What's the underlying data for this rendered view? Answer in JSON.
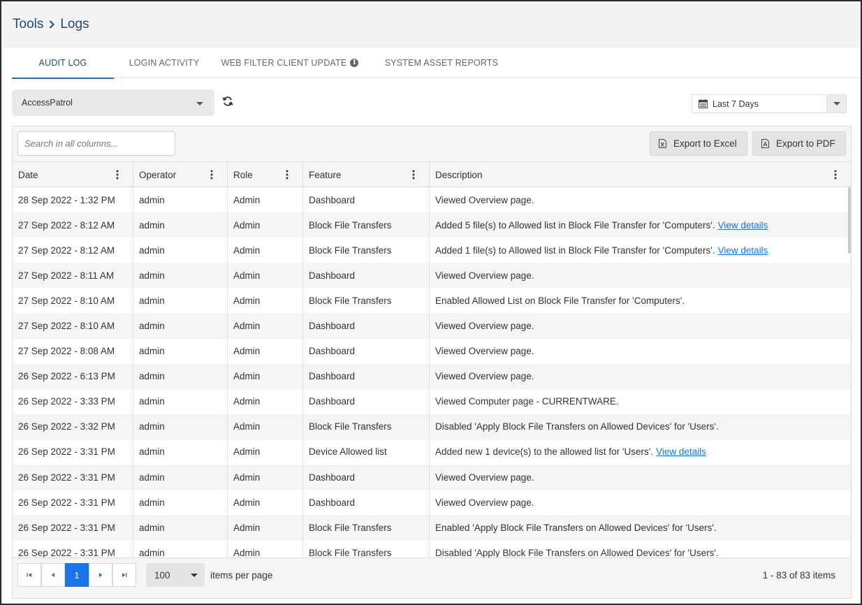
{
  "breadcrumb": {
    "root": "Tools",
    "current": "Logs"
  },
  "tabs": [
    {
      "label": "AUDIT LOG",
      "active": true
    },
    {
      "label": "LOGIN ACTIVITY",
      "active": false
    },
    {
      "label": "WEB FILTER CLIENT UPDATE",
      "active": false,
      "icon": "info-icon"
    },
    {
      "label": "SYSTEM ASSET REPORTS",
      "active": false
    }
  ],
  "filters": {
    "company": "AccessPatrol",
    "date_range": "Last 7 Days"
  },
  "toolbar": {
    "search_placeholder": "Search in all columns...",
    "export_excel": "Export to Excel",
    "export_pdf": "Export to PDF"
  },
  "columns": [
    "Date",
    "Operator",
    "Role",
    "Feature",
    "Description"
  ],
  "rows": [
    {
      "date": "28 Sep 2022 - 1:32 PM",
      "operator": "admin",
      "role": "Admin",
      "feature": "Dashboard",
      "description": "Viewed Overview page.",
      "link": ""
    },
    {
      "date": "27 Sep 2022 - 8:12 AM",
      "operator": "admin",
      "role": "Admin",
      "feature": "Block File Transfers",
      "description": "Added 5 file(s) to Allowed list in Block File Transfer for 'Computers'.",
      "link": "View details"
    },
    {
      "date": "27 Sep 2022 - 8:12 AM",
      "operator": "admin",
      "role": "Admin",
      "feature": "Block File Transfers",
      "description": "Added 1 file(s) to Allowed list in Block File Transfer for 'Computers'.",
      "link": "View details"
    },
    {
      "date": "27 Sep 2022 - 8:11 AM",
      "operator": "admin",
      "role": "Admin",
      "feature": "Dashboard",
      "description": "Viewed Overview page.",
      "link": ""
    },
    {
      "date": "27 Sep 2022 - 8:10 AM",
      "operator": "admin",
      "role": "Admin",
      "feature": "Block File Transfers",
      "description": "Enabled Allowed List on Block File Transfer for 'Computers'.",
      "link": ""
    },
    {
      "date": "27 Sep 2022 - 8:10 AM",
      "operator": "admin",
      "role": "Admin",
      "feature": "Dashboard",
      "description": "Viewed Overview page.",
      "link": ""
    },
    {
      "date": "27 Sep 2022 - 8:08 AM",
      "operator": "admin",
      "role": "Admin",
      "feature": "Dashboard",
      "description": "Viewed Overview page.",
      "link": ""
    },
    {
      "date": "26 Sep 2022 - 6:13 PM",
      "operator": "admin",
      "role": "Admin",
      "feature": "Dashboard",
      "description": "Viewed Overview page.",
      "link": ""
    },
    {
      "date": "26 Sep 2022 - 3:33 PM",
      "operator": "admin",
      "role": "Admin",
      "feature": "Dashboard",
      "description": "Viewed Computer page - CURRENTWARE.",
      "link": ""
    },
    {
      "date": "26 Sep 2022 - 3:32 PM",
      "operator": "admin",
      "role": "Admin",
      "feature": "Block File Transfers",
      "description": "Disabled 'Apply Block File Transfers on Allowed Devices' for 'Users'.",
      "link": ""
    },
    {
      "date": "26 Sep 2022 - 3:31 PM",
      "operator": "admin",
      "role": "Admin",
      "feature": "Device Allowed list",
      "description": "Added new 1 device(s) to the allowed list for 'Users'.",
      "link": "View details"
    },
    {
      "date": "26 Sep 2022 - 3:31 PM",
      "operator": "admin",
      "role": "Admin",
      "feature": "Dashboard",
      "description": "Viewed Overview page.",
      "link": ""
    },
    {
      "date": "26 Sep 2022 - 3:31 PM",
      "operator": "admin",
      "role": "Admin",
      "feature": "Dashboard",
      "description": "Viewed Overview page.",
      "link": ""
    },
    {
      "date": "26 Sep 2022 - 3:31 PM",
      "operator": "admin",
      "role": "Admin",
      "feature": "Block File Transfers",
      "description": "Enabled 'Apply Block File Transfers on Allowed Devices' for 'Users'.",
      "link": ""
    },
    {
      "date": "26 Sep 2022 - 3:31 PM",
      "operator": "admin",
      "role": "Admin",
      "feature": "Block File Transfers",
      "description": "Disabled 'Apply Block File Transfers on Allowed Devices' for 'Users'.",
      "link": ""
    }
  ],
  "pager": {
    "current_page": "1",
    "page_size": "100",
    "page_size_label": "items per page",
    "summary": "1 - 83 of 83 items"
  },
  "colors": {
    "accent": "#1a73e8",
    "brand": "#1d4a78"
  }
}
